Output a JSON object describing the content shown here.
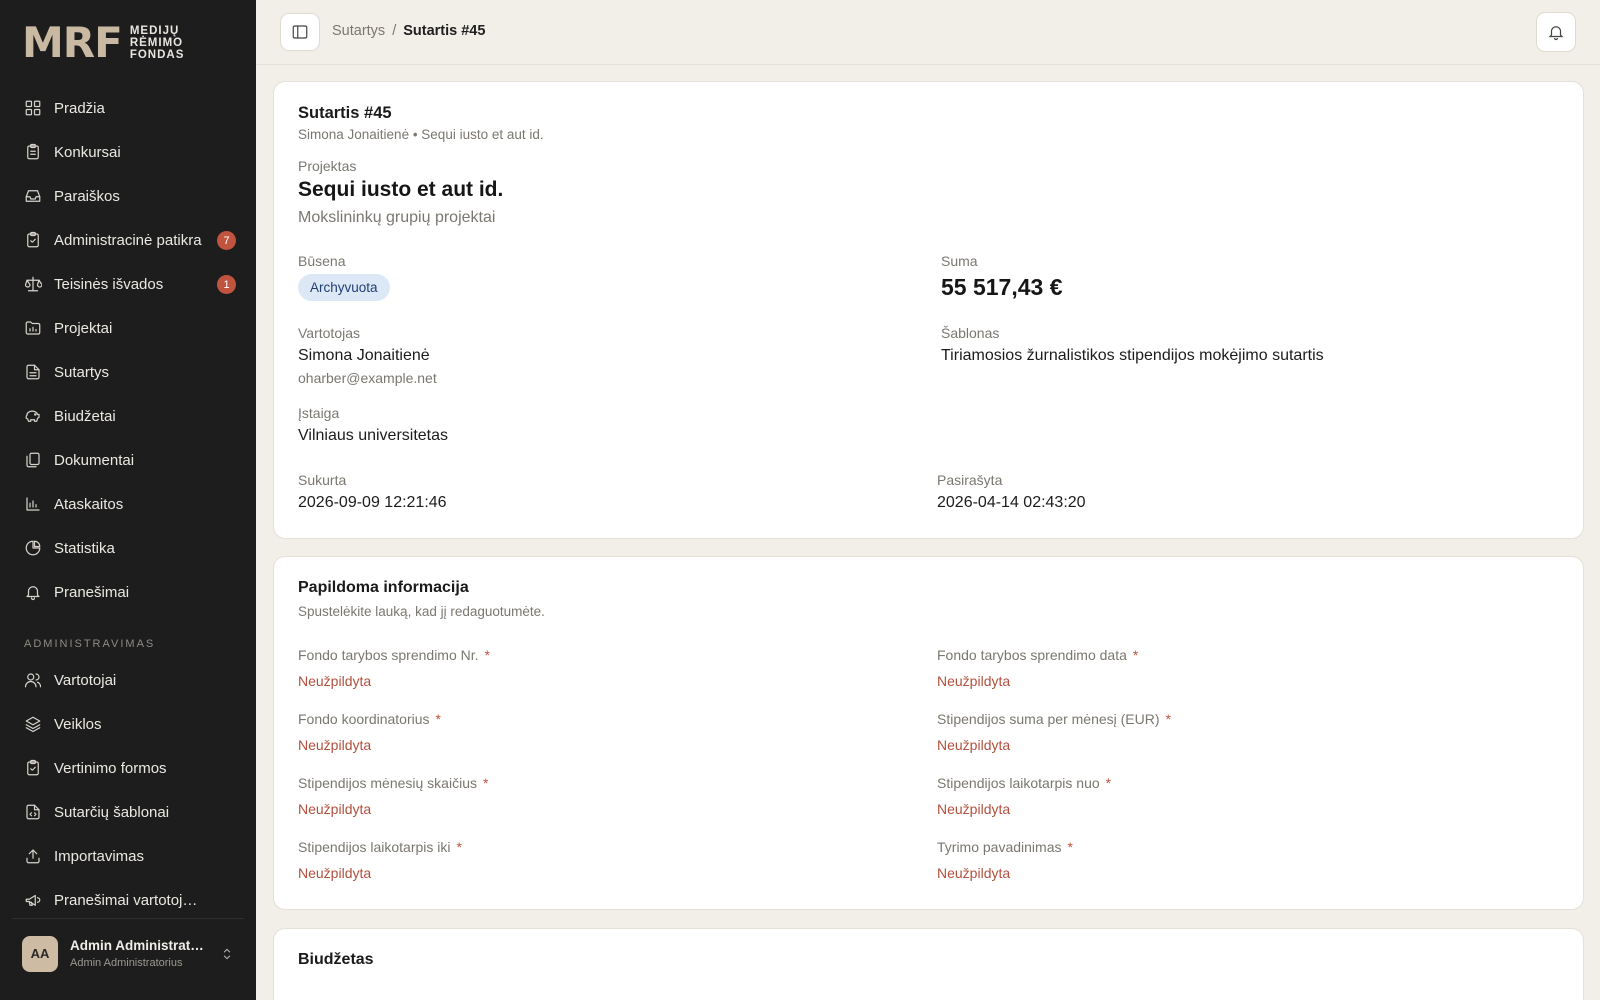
{
  "brand": {
    "mark": "MRF",
    "line1": "MEDIJŲ",
    "line2": "RĖMIMO",
    "line3": "FONDAS"
  },
  "sidebar": {
    "items": [
      {
        "label": "Pradžia",
        "icon": "grid-icon"
      },
      {
        "label": "Konkursai",
        "icon": "clipboard-icon"
      },
      {
        "label": "Paraiškos",
        "icon": "inbox-icon"
      },
      {
        "label": "Administracinė patikra",
        "icon": "clipboard-check-icon",
        "badge": "7"
      },
      {
        "label": "Teisinės išvados",
        "icon": "scale-icon",
        "badge": "1"
      },
      {
        "label": "Projektai",
        "icon": "folder-icon"
      },
      {
        "label": "Sutartys",
        "icon": "file-icon"
      },
      {
        "label": "Biudžetai",
        "icon": "piggy-bank-icon"
      },
      {
        "label": "Dokumentai",
        "icon": "files-icon"
      },
      {
        "label": "Ataskaitos",
        "icon": "bar-chart-icon"
      },
      {
        "label": "Statistika",
        "icon": "pie-chart-icon"
      },
      {
        "label": "Pranešimai",
        "icon": "bell-icon"
      }
    ],
    "section_title": "ADMINISTRAVIMAS",
    "admin_items": [
      {
        "label": "Vartotojai",
        "icon": "users-icon"
      },
      {
        "label": "Veiklos",
        "icon": "layers-icon"
      },
      {
        "label": "Vertinimo formos",
        "icon": "clipboard-check-icon"
      },
      {
        "label": "Sutarčių šablonai",
        "icon": "file-code-icon"
      },
      {
        "label": "Importavimas",
        "icon": "upload-icon"
      },
      {
        "label": "Pranešimai vartotojams",
        "icon": "megaphone-icon"
      }
    ],
    "user": {
      "initials": "AA",
      "name": "Admin Administratorius",
      "role": "Admin Administratorius"
    }
  },
  "topbar": {
    "crumb_parent": "Sutartys",
    "crumb_sep": "/",
    "crumb_current": "Sutartis #45"
  },
  "contract": {
    "title": "Sutartis #45",
    "subtitle": "Simona Jonaitienė • Sequi iusto et aut id.",
    "project_label": "Projektas",
    "project_name": "Sequi iusto et aut id.",
    "project_program": "Mokslininkų grupių projektai",
    "status_label": "Būsena",
    "status_value": "Archyvuota",
    "sum_label": "Suma",
    "sum_value": "55 517,43 €",
    "user_label": "Vartotojas",
    "user_name": "Simona Jonaitienė",
    "user_email": "oharber@example.net",
    "template_label": "Šablonas",
    "template_value": "Tiriamosios žurnalistikos stipendijos mokėjimo sutartis",
    "institution_label": "Įstaiga",
    "institution_value": "Vilniaus universitetas",
    "created_label": "Sukurta",
    "created_value": "2026-09-09 12:21:46",
    "signed_label": "Pasirašyta",
    "signed_value": "2026-04-14 02:43:20"
  },
  "extra": {
    "title": "Papildoma informacija",
    "subtitle": "Spustelėkite lauką, kad jį redaguotumėte.",
    "required_mark": "*",
    "fields": [
      {
        "label": "Fondo tarybos sprendimo Nr.",
        "value": "Neužpildyta"
      },
      {
        "label": "Fondo tarybos sprendimo data",
        "value": "Neužpildyta"
      },
      {
        "label": "Fondo koordinatorius",
        "value": "Neužpildyta"
      },
      {
        "label": "Stipendijos suma per mėnesį (EUR)",
        "value": "Neužpildyta"
      },
      {
        "label": "Stipendijos mėnesių skaičius",
        "value": "Neužpildyta"
      },
      {
        "label": "Stipendijos laikotarpis nuo",
        "value": "Neužpildyta"
      },
      {
        "label": "Stipendijos laikotarpis iki",
        "value": "Neužpildyta"
      },
      {
        "label": "Tyrimo pavadinimas",
        "value": "Neužpildyta"
      }
    ]
  },
  "budget": {
    "title": "Biudžetas"
  }
}
